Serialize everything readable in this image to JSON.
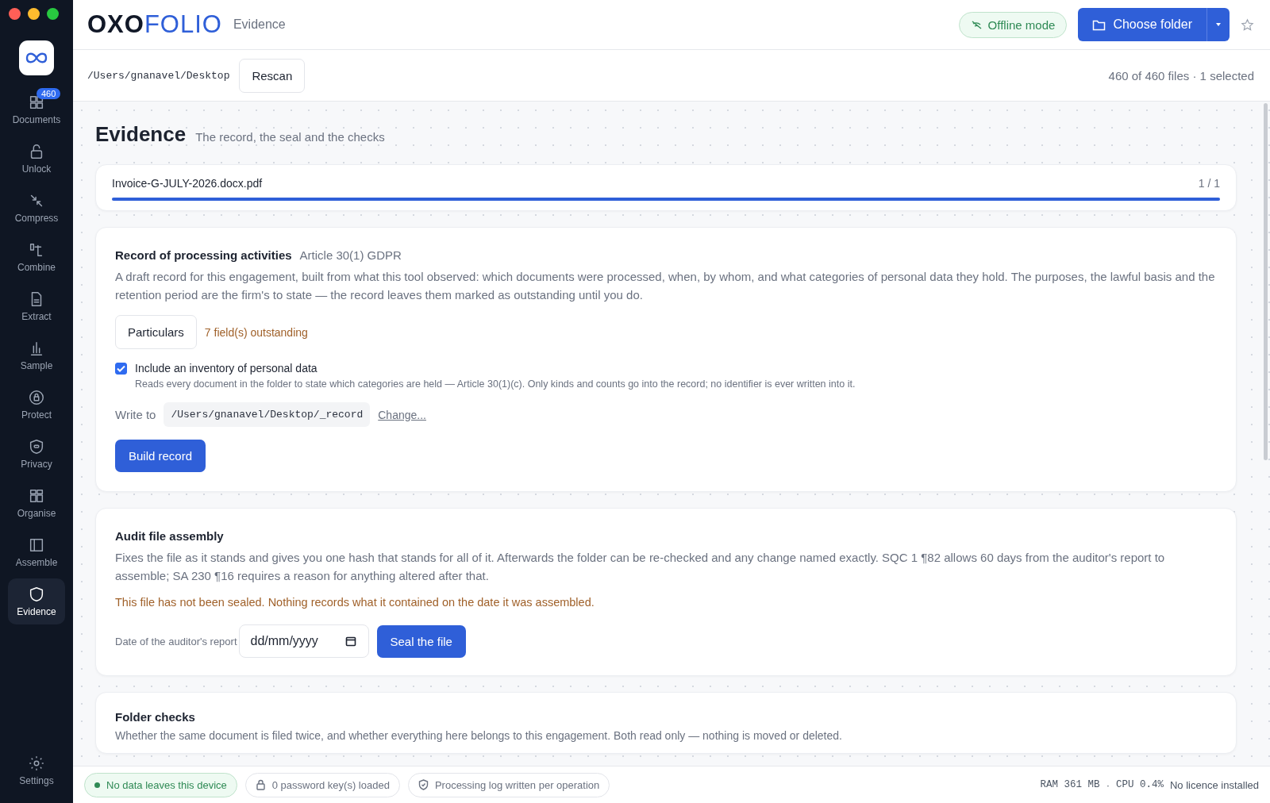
{
  "sidebar": {
    "items": [
      {
        "label": "Documents",
        "selected": false,
        "badge": "460"
      },
      {
        "label": "Unlock",
        "selected": false
      },
      {
        "label": "Compress",
        "selected": false
      },
      {
        "label": "Combine",
        "selected": false
      },
      {
        "label": "Extract",
        "selected": false
      },
      {
        "label": "Sample",
        "selected": false
      },
      {
        "label": "Protect",
        "selected": false
      },
      {
        "label": "Privacy",
        "selected": false
      },
      {
        "label": "Organise",
        "selected": false
      },
      {
        "label": "Assemble",
        "selected": false
      },
      {
        "label": "Evidence",
        "selected": true
      }
    ],
    "footer": {
      "label": "Settings"
    }
  },
  "header": {
    "logo": {
      "part_1": "OXO",
      "part_2": "FOLIO"
    },
    "section": "Evidence",
    "offline_badge": "Offline mode",
    "choose_button": "Choose folder"
  },
  "path_bar": {
    "path": "/Users/gnanavel/Desktop",
    "rescan": "Rescan",
    "summary": "460 of 460 files · 1 selected"
  },
  "page": {
    "title": "Evidence",
    "subtitle": "The record, the seal and the checks"
  },
  "file_card": {
    "name": "Invoice-G-JULY-2026.docx.pdf",
    "position": "1 / 1",
    "level": 1
  },
  "record_card": {
    "title": "Record of processing activities",
    "reference": "Article 30(1) GDPR",
    "description": "A draft record for this engagement, built from what this tool observed: which documents were processed, when, by whom, and what categories of personal data they hold. The purposes, the lawful basis and the retention period are the firm's to state — the record leaves them marked as outstanding until you do.",
    "particulars_button": "Particulars",
    "outstanding": "7 field(s) outstanding",
    "inventory": {
      "label": "Include an inventory of personal data",
      "checked": true,
      "hint": "Reads every document in the folder to state which categories are held — Article 30(1)(c). Only kinds and counts go into the record; no identifier is ever written into it."
    },
    "write_to_label": "Write to",
    "write_to_path": "/Users/gnanavel/Desktop/_record",
    "change_link": "Change...",
    "build_button": "Build record"
  },
  "audit_card": {
    "title": "Audit file assembly",
    "description": "Fixes the file as it stands and gives you one hash that stands for all of it. Afterwards the folder can be re-checked and any change named exactly. SQC 1 ¶82 allows 60 days from the auditor's report to assemble; SA 230 ¶16 requires a reason for anything altered after that.",
    "warning": "This file has not been sealed. Nothing records what it contained on the date it was assembled.",
    "date_label": "Date of the auditor's report",
    "date_field": {
      "placeholder": "dd/mm/yyyy"
    },
    "seal_button": "Seal the file"
  },
  "folder_card": {
    "title": "Folder checks",
    "description": "Whether the same document is filed twice, and whether everything here belongs to this engagement. Both read only — nothing is moved or deleted."
  },
  "status_bar": {
    "pills": [
      {
        "kind": "ok",
        "text": "No data leaves this device"
      },
      {
        "kind": "lock",
        "text": "0 password key(s) loaded"
      },
      {
        "kind": "shield",
        "text": "Processing log written per operation"
      }
    ],
    "ram": "RAM 361 MB",
    "separator": "·",
    "cpu": "CPU 0.4%",
    "licence": "No licence installed"
  }
}
